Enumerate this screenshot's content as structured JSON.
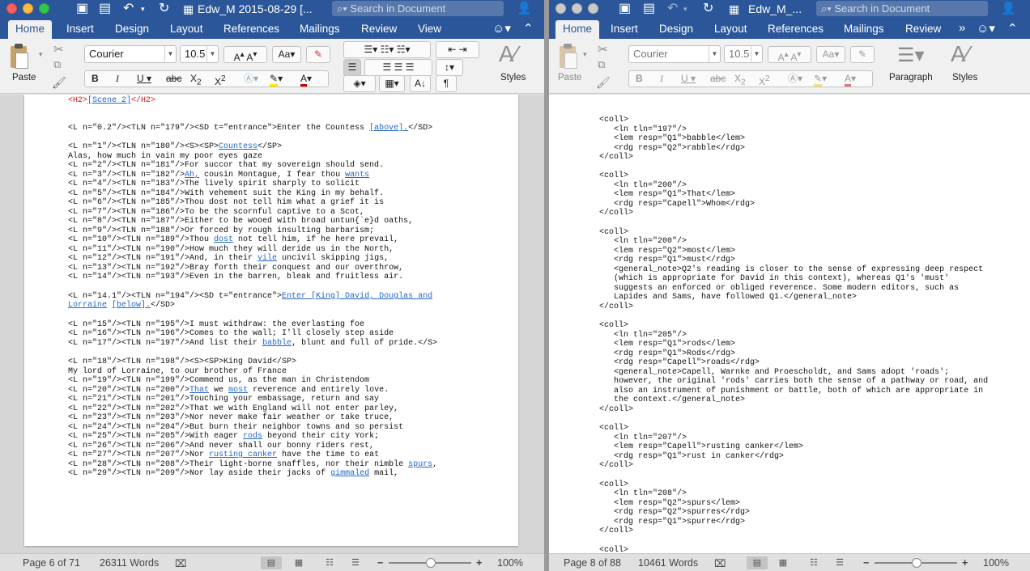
{
  "left": {
    "search_placeholder": "Search in Document",
    "doc_title": "Edw_M 2015-08-29 [...",
    "tabs": [
      "Home",
      "Insert",
      "Design",
      "Layout",
      "References",
      "Mailings",
      "Review",
      "View"
    ],
    "font": "Courier",
    "size": "10.5",
    "paste_label": "Paste",
    "styles_label": "Styles",
    "lines": [
      [
        [
          "<H2>",
          "red"
        ],
        [
          "[Scene 2]",
          "blu"
        ],
        [
          "</H2>",
          "red"
        ]
      ],
      [
        [
          "<L n=\"0.2\"/><TLN n=\"179\"/><SD t=\"entrance\">Enter the Countess ",
          ""
        ],
        [
          "[above].",
          "blu"
        ],
        [
          "</SD>",
          ""
        ]
      ],
      [
        [
          "<L n=\"1\"/><TLN n=\"180\"/><S><SP>",
          ""
        ],
        [
          "Countess",
          "blu"
        ],
        [
          "</SP>",
          ""
        ]
      ],
      [
        [
          "Alas, how much in vain my poor eyes gaze",
          ""
        ]
      ],
      [
        [
          "<L n=\"2\"/><TLN n=\"181\"/>For succor that my sovereign should send.",
          ""
        ]
      ],
      [
        [
          "<L n=\"3\"/><TLN n=\"182\"/>",
          ""
        ],
        [
          "Ah,",
          "blu"
        ],
        [
          " cousin Montague, I fear thou ",
          ""
        ],
        [
          "wants",
          "blu"
        ]
      ],
      [
        [
          "<L n=\"4\"/><TLN n=\"183\"/>The lively spirit sharply to solicit",
          ""
        ]
      ],
      [
        [
          "<L n=\"5\"/><TLN n=\"184\"/>With vehement suit the King in my behalf.",
          ""
        ]
      ],
      [
        [
          "<L n=\"6\"/><TLN n=\"185\"/>Thou dost not tell him what a grief it is",
          ""
        ]
      ],
      [
        [
          "<L n=\"7\"/><TLN n=\"186\"/>To be the scornful captive to a Scot,",
          ""
        ]
      ],
      [
        [
          "<L n=\"8\"/><TLN n=\"187\"/>Either to be wooed with broad untun{`e}d oaths,",
          ""
        ]
      ],
      [
        [
          "<L n=\"9\"/><TLN n=\"188\"/>Or forced by rough insulting barbarism;",
          ""
        ]
      ],
      [
        [
          "<L n=\"10\"/><TLN n=\"189\"/>Thou ",
          ""
        ],
        [
          "dost",
          "blu"
        ],
        [
          " not tell him, if he here prevail,",
          ""
        ]
      ],
      [
        [
          "<L n=\"11\"/><TLN n=\"190\"/>How much they will deride us in the North,",
          ""
        ]
      ],
      [
        [
          "<L n=\"12\"/><TLN n=\"191\"/>And, in their ",
          ""
        ],
        [
          "vile",
          "blu"
        ],
        [
          " uncivil skipping jigs,",
          ""
        ]
      ],
      [
        [
          "<L n=\"13\"/><TLN n=\"192\"/>Bray forth their conquest and our overthrow,",
          ""
        ]
      ],
      [
        [
          "<L n=\"14\"/><TLN n=\"193\"/>Even in the barren, bleak and fruitless air.",
          ""
        ]
      ],
      [
        [
          "<L n=\"14.1\"/><TLN n=\"194\"/><SD t=\"entrance\">",
          ""
        ],
        [
          "Enter [King] David, Douglas and",
          "blu"
        ]
      ],
      [
        [
          "Lorraine",
          "blu"
        ],
        [
          " ",
          ""
        ],
        [
          "[below].",
          "blu"
        ],
        [
          "</SD>",
          ""
        ]
      ],
      [
        [
          "<L n=\"15\"/><TLN n=\"195\"/>I must withdraw: the everlasting foe",
          ""
        ]
      ],
      [
        [
          "<L n=\"16\"/><TLN n=\"196\"/>Comes to the wall; I'll closely step aside",
          ""
        ]
      ],
      [
        [
          "<L n=\"17\"/><TLN n=\"197\"/>And list their ",
          ""
        ],
        [
          "babble",
          "blu"
        ],
        [
          ", blunt and full of pride.</S>",
          ""
        ]
      ],
      [
        [
          "<L n=\"18\"/><TLN n=\"198\"/><S><SP>King David</SP>",
          ""
        ]
      ],
      [
        [
          "My lord of Lorraine, to our brother of France",
          ""
        ]
      ],
      [
        [
          "<L n=\"19\"/><TLN n=\"199\"/>Commend us, as the man in Christendom",
          ""
        ]
      ],
      [
        [
          "<L n=\"20\"/><TLN n=\"200\"/>",
          ""
        ],
        [
          "That",
          "blu"
        ],
        [
          " we ",
          ""
        ],
        [
          "most",
          "blu"
        ],
        [
          " reverence and entirely love.",
          ""
        ]
      ],
      [
        [
          "<L n=\"21\"/><TLN n=\"201\"/>Touching your embassage, return and say",
          ""
        ]
      ],
      [
        [
          "<L n=\"22\"/><TLN n=\"202\"/>That we with England will not enter parley,",
          ""
        ]
      ],
      [
        [
          "<L n=\"23\"/><TLN n=\"203\"/>Nor never make fair weather or take truce,",
          ""
        ]
      ],
      [
        [
          "<L n=\"24\"/><TLN n=\"204\"/>But burn their neighbor towns and so persist",
          ""
        ]
      ],
      [
        [
          "<L n=\"25\"/><TLN n=\"205\"/>With eager ",
          ""
        ],
        [
          "rods",
          "blu"
        ],
        [
          " beyond their city York;",
          ""
        ]
      ],
      [
        [
          "<L n=\"26\"/><TLN n=\"206\"/>And never shall our bonny riders rest,",
          ""
        ]
      ],
      [
        [
          "<L n=\"27\"/><TLN n=\"207\"/>Nor ",
          ""
        ],
        [
          "rusting canker",
          "blu"
        ],
        [
          " have the time to eat",
          ""
        ]
      ],
      [
        [
          "<L n=\"28\"/><TLN n=\"208\"/>Their light-borne snaffles, nor their nimble ",
          ""
        ],
        [
          "spurs",
          "blu"
        ],
        [
          ",",
          ""
        ]
      ],
      [
        [
          "<L n=\"29\"/><TLN n=\"209\"/>Nor lay aside their jacks of ",
          ""
        ],
        [
          "gimmaled",
          "blu"
        ],
        [
          " mail,",
          ""
        ]
      ]
    ],
    "status": {
      "page": "Page 6 of 71",
      "words": "26311 Words",
      "zoom": "100%"
    }
  },
  "right": {
    "search_placeholder": "Search in Document",
    "doc_title": "Edw_M_...",
    "tabs": [
      "Home",
      "Insert",
      "Design",
      "Layout",
      "References",
      "Mailings",
      "Review"
    ],
    "font": "Courier",
    "size": "10.5",
    "paste_label": "Paste",
    "paragraph_label": "Paragraph",
    "styles_label": "Styles",
    "lines": [
      "<coll>",
      "   <ln tln=\"197\"/>",
      "   <lem resp=\"Q1\">babble</lem>",
      "   <rdg resp=\"Q2\">rabble</rdg>",
      "</coll>",
      "<coll>",
      "   <ln tln=\"200\"/>",
      "   <lem resp=\"Q1\">That</lem>",
      "   <rdg resp=\"Capell\">Whom</rdg>",
      "</coll>",
      "<coll>",
      "   <ln tln=\"200\"/>",
      "   <lem resp=\"Q2\">most</lem>",
      "   <rdg resp=\"Q1\">must</rdg>",
      "   <general_note>Q2's reading is closer to the sense of expressing deep respect",
      "   (which is appropriate for David in this context), whereas Q1's 'must'",
      "   suggests an enforced or obliged reverence. Some modern editors, such as",
      "   Lapides and Sams, have followed Q1.</general_note>",
      "</coll>",
      "<coll>",
      "   <ln tln=\"205\"/>",
      "   <lem resp=\"Q1\">rods</lem>",
      "   <rdg resp=\"Q1\">Rods</rdg>",
      "   <rdg resp=\"Capell\">roads</rdg>",
      "   <general_note>Capell, Warnke and Proescholdt, and Sams adopt 'roads';",
      "   however, the original 'rods' carries both the sense of a pathway or road, and",
      "   also an instrument of punishment or battle, both of which are appropriate in",
      "   the context.</general_note>",
      "</coll>",
      "<coll>",
      "   <ln tln=\"207\"/>",
      "   <lem resp=\"Capell\">rusting canker</lem>",
      "   <rdg resp=\"Q1\">rust in canker</rdg>",
      "</coll>",
      "<coll>",
      "   <ln tln=\"208\"/>",
      "   <lem resp=\"Q2\">spurs</lem>",
      "   <rdg resp=\"Q2\">spurres</rdg>",
      "   <rdg resp=\"Q1\">spurre</rdg>",
      "</coll>",
      "<coll>"
    ],
    "status": {
      "page": "Page 8 of 88",
      "words": "10461 Words",
      "zoom": "100%"
    }
  },
  "icons": {
    "sidebar": "sidebar-icon",
    "save": "save-icon",
    "undo": "undo-icon",
    "redo": "redo-icon",
    "doc": "document-icon",
    "search": "search-icon",
    "share": "share-person-icon",
    "smiley": "smiley-feedback-icon"
  }
}
